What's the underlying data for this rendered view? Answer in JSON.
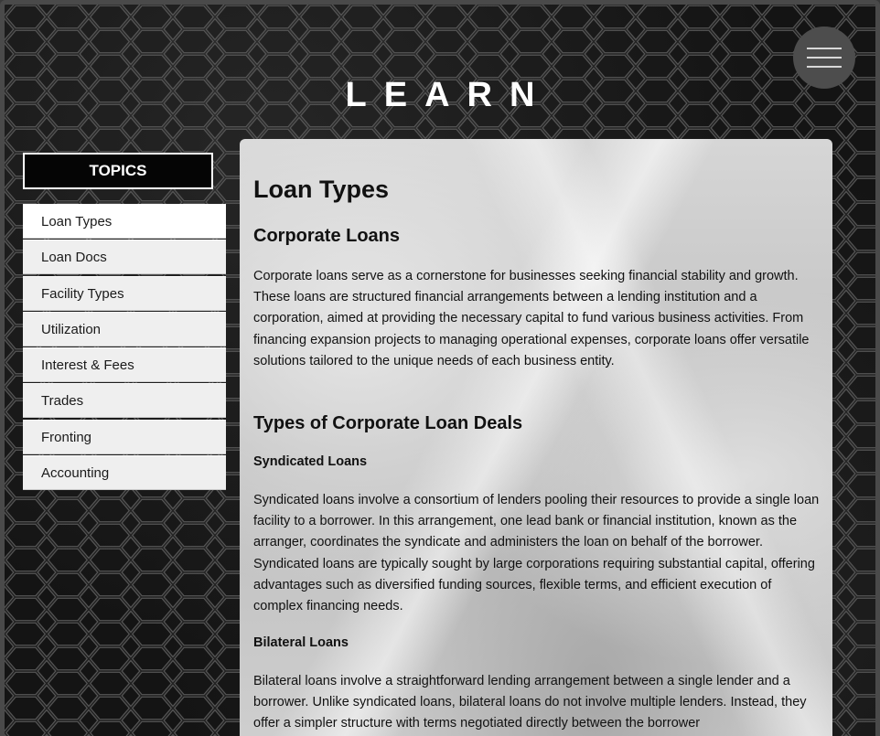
{
  "header": {
    "title": "LEARN",
    "menu_icon": "hamburger-menu-icon"
  },
  "sidebar": {
    "heading": "TOPICS",
    "items": [
      {
        "label": "Loan Types",
        "active": true
      },
      {
        "label": "Loan Docs",
        "active": false
      },
      {
        "label": "Facility Types",
        "active": false
      },
      {
        "label": "Utilization",
        "active": false
      },
      {
        "label": "Interest & Fees",
        "active": false
      },
      {
        "label": "Trades",
        "active": false
      },
      {
        "label": "Fronting",
        "active": false
      },
      {
        "label": "Accounting",
        "active": false
      }
    ]
  },
  "content": {
    "title": "Loan Types",
    "section1": {
      "heading": "Corporate Loans",
      "paragraph": "Corporate loans serve as a cornerstone for businesses seeking financial stability and growth. These loans are structured financial arrangements between a lending institution and a corporation, aimed at providing the necessary capital to fund various business activities. From financing expansion projects to managing operational expenses, corporate loans offer versatile solutions tailored to the unique needs of each business entity."
    },
    "section2": {
      "heading": "Types of Corporate Loan Deals",
      "syndicated": {
        "heading": "Syndicated Loans",
        "paragraph": "Syndicated loans involve a consortium of lenders pooling their resources to provide a single loan facility to a borrower. In this arrangement, one lead bank or financial institution, known as the arranger, coordinates the syndicate and administers the loan on behalf of the borrower. Syndicated loans are typically sought by large corporations requiring substantial capital, offering advantages such as diversified funding sources, flexible terms, and efficient execution of complex financing needs."
      },
      "bilateral": {
        "heading": "Bilateral Loans",
        "paragraph": "Bilateral loans involve a straightforward lending arrangement between a single lender and a borrower. Unlike syndicated loans, bilateral loans do not involve multiple lenders. Instead, they offer a simpler structure with terms negotiated directly between the borrower"
      }
    }
  },
  "colors": {
    "background": "#141414",
    "panel": "#c9c9c9",
    "title_text": "#ffffff",
    "menu_button": "#4d4d4d"
  }
}
